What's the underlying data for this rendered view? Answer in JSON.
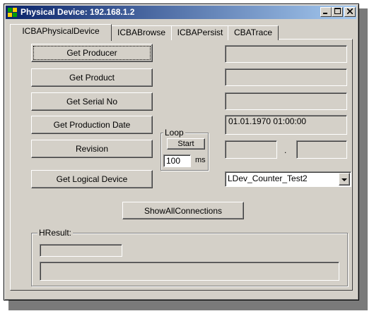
{
  "window": {
    "title": "Physical Device: 192.168.1.2",
    "minimize_icon": "minimize-icon",
    "maximize_icon": "maximize-icon",
    "close_icon": "close-icon"
  },
  "tabs": [
    {
      "label": "ICBAPhysicalDevice",
      "active": true
    },
    {
      "label": "ICBABrowse",
      "active": false
    },
    {
      "label": "ICBAPersist",
      "active": false
    },
    {
      "label": "CBATrace",
      "active": false
    }
  ],
  "buttons": {
    "get_producer": "Get Producer",
    "get_product": "Get Product",
    "get_serial_no": "Get Serial No",
    "get_production_date": "Get Production Date",
    "revision": "Revision",
    "get_logical_device": "Get Logical Device",
    "show_all_connections": "ShowAllConnections"
  },
  "fields": {
    "producer": "",
    "product": "",
    "serial_no": "",
    "production_date": "01.01.1970 01:00:00",
    "revision_major": "",
    "revision_separator": ".",
    "revision_minor": ""
  },
  "loop": {
    "label": "Loop",
    "start_label": "Start",
    "interval_value": "100",
    "unit": "ms"
  },
  "logical_device_select": {
    "selected": "LDev_Counter_Test2"
  },
  "hresult": {
    "label": "HResult:",
    "code": "",
    "message": ""
  },
  "colors": {
    "title_gradient_start": "#0a246a",
    "title_gradient_end": "#a6caf0",
    "face": "#d4d0c8"
  }
}
